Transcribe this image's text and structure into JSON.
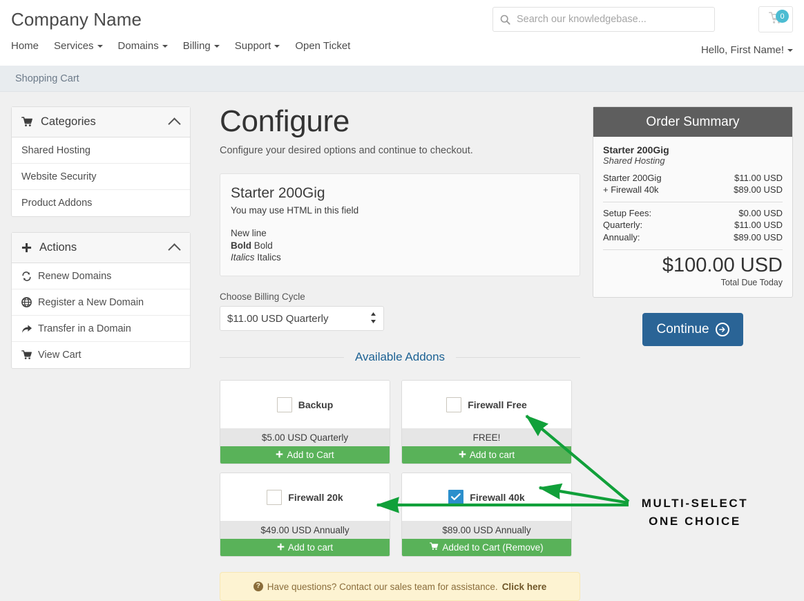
{
  "header": {
    "brand": "Company Name",
    "search": {
      "placeholder": "Search our knowledgebase...",
      "value": "",
      "icon": "search-icon"
    },
    "cart": {
      "icon": "shopping-cart-icon",
      "badge": "0"
    },
    "nav": [
      {
        "label": "Home",
        "has_caret": false
      },
      {
        "label": "Services",
        "has_caret": true
      },
      {
        "label": "Domains",
        "has_caret": true
      },
      {
        "label": "Billing",
        "has_caret": true
      },
      {
        "label": "Support",
        "has_caret": true
      },
      {
        "label": "Open Ticket",
        "has_caret": false
      }
    ],
    "account": "Hello, First Name!"
  },
  "breadcrumb": {
    "label": "Shopping Cart"
  },
  "sidebar": {
    "categories": {
      "title": "Categories",
      "icon": "shopping-cart-icon",
      "collapse_icon": "chevron-up-icon",
      "items": [
        {
          "label": "Shared Hosting"
        },
        {
          "label": "Website Security"
        },
        {
          "label": "Product Addons"
        }
      ]
    },
    "actions": {
      "title": "Actions",
      "icon": "plus-icon",
      "collapse_icon": "chevron-up-icon",
      "items": [
        {
          "label": "Renew Domains",
          "icon": "refresh-icon",
          "glyph": "↻"
        },
        {
          "label": "Register a New Domain",
          "icon": "globe-icon",
          "glyph": "⊕"
        },
        {
          "label": "Transfer in a Domain",
          "icon": "share-arrow-icon",
          "glyph": "↪"
        },
        {
          "label": "View Cart",
          "icon": "shopping-cart-icon",
          "glyph": "🛒"
        }
      ]
    }
  },
  "main": {
    "title": "Configure",
    "subtitle": "Configure your desired options and continue to checkout.",
    "product": {
      "name": "Starter 200Gig",
      "desc_line1": "You may use HTML in this field",
      "desc_line2": "New line",
      "desc_bold": "Bold",
      "desc_bold_rest": " Bold",
      "desc_italic": "Italics",
      "desc_italic_rest": " Italics"
    },
    "billing": {
      "label": "Choose Billing Cycle",
      "selected": "$11.00 USD Quarterly",
      "options": [
        "$11.00 USD Quarterly"
      ]
    },
    "addons_divider_label": "Available Addons",
    "addons": [
      {
        "name": "Backup",
        "price": "$5.00 USD Quarterly",
        "button": "Add to Cart",
        "button_icon": "plus-icon",
        "checked": false
      },
      {
        "name": "Firewall Free",
        "price": "FREE!",
        "button": "Add to cart",
        "button_icon": "plus-icon",
        "checked": false
      },
      {
        "name": "Firewall 20k",
        "price": "$49.00 USD Annually",
        "button": "Add to cart",
        "button_icon": "plus-icon",
        "checked": false
      },
      {
        "name": "Firewall 40k",
        "price": "$89.00 USD Annually",
        "button": "Added to Cart (Remove)",
        "button_icon": "shopping-cart-icon",
        "checked": true
      }
    ],
    "help_alert": {
      "icon": "question-circle-icon",
      "text": "Have questions? Contact our sales team for assistance.",
      "link": "Click here"
    }
  },
  "order_summary": {
    "title": "Order Summary",
    "product_name": "Starter 200Gig",
    "product_category": "Shared Hosting",
    "items": [
      {
        "label": "Starter 200Gig",
        "value": "$11.00 USD"
      },
      {
        "label": "+ Firewall 40k",
        "value": "$89.00 USD"
      }
    ],
    "fees": [
      {
        "label": "Setup Fees:",
        "value": "$0.00 USD"
      },
      {
        "label": "Quarterly:",
        "value": "$11.00 USD"
      },
      {
        "label": "Annually:",
        "value": "$89.00 USD"
      }
    ],
    "total": "$100.00 USD",
    "total_label": "Total Due Today",
    "continue_label": "Continue",
    "continue_icon": "arrow-right-circle-icon"
  },
  "annotation": {
    "line1": "MULTI-SELECT",
    "line2": "ONE CHOICE",
    "color": "#11a03a"
  },
  "colors": {
    "accent_blue": "#2a6496",
    "link_blue": "#1d6294",
    "green_button": "#59b259",
    "checkbox_blue": "#2b8fcc",
    "badge_teal": "#4cbcd2",
    "summary_header": "#5e5e5e",
    "annotation_green": "#11a03a"
  }
}
